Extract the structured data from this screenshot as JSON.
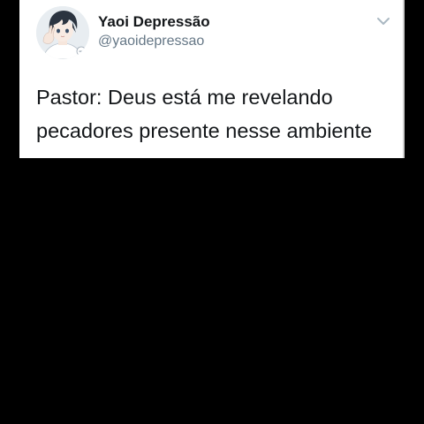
{
  "tweet": {
    "display_name": "Yaoi Depressão",
    "username": "@yaoidepressao",
    "text": "Pastor: Deus está me revelando\npecadores presente nesse ambiente",
    "avatar_icon": "anime-boy-avatar-icon",
    "menu_icon": "chevron-down-icon"
  },
  "colors": {
    "background": "#000000",
    "card": "#ffffff",
    "name": "#14171a",
    "handle": "#657786"
  }
}
